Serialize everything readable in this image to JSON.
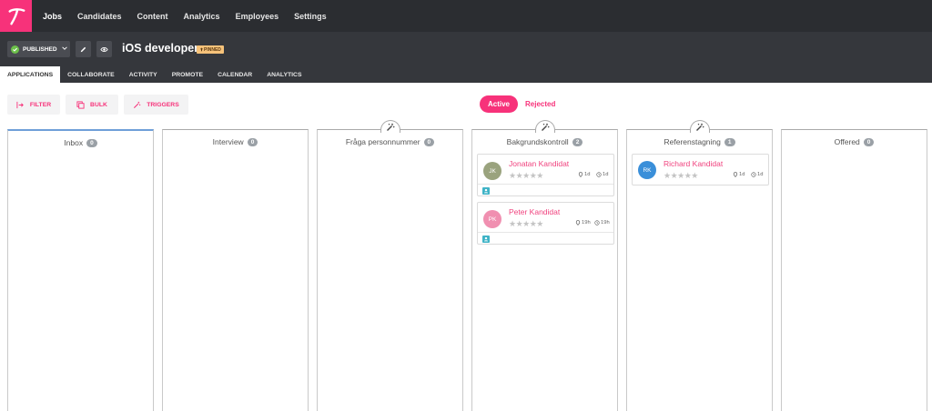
{
  "nav": {
    "items": [
      {
        "label": "Jobs"
      },
      {
        "label": "Candidates"
      },
      {
        "label": "Content"
      },
      {
        "label": "Analytics"
      },
      {
        "label": "Employees"
      },
      {
        "label": "Settings"
      }
    ],
    "active_index": 0
  },
  "job": {
    "status": "PUBLISHED",
    "title": "iOS developer",
    "badge": "PINNED"
  },
  "tabs": [
    {
      "label": "APPLICATIONS"
    },
    {
      "label": "COLLABORATE"
    },
    {
      "label": "ACTIVITY"
    },
    {
      "label": "PROMOTE"
    },
    {
      "label": "CALENDAR"
    },
    {
      "label": "ANALYTICS"
    }
  ],
  "toolbar": {
    "filter": "FILTER",
    "bulk": "BULK",
    "triggers": "TRIGGERS"
  },
  "toggle": {
    "active": "Active",
    "rejected": "Rejected"
  },
  "stages": [
    {
      "name": "Inbox",
      "count": "0"
    },
    {
      "name": "Interview",
      "count": "0"
    },
    {
      "name": "Fråga personnummer",
      "count": "0"
    },
    {
      "name": "Bakgrundskontroll",
      "count": "2"
    },
    {
      "name": "Referenstagning",
      "count": "1"
    },
    {
      "name": "Offered",
      "count": "0"
    }
  ],
  "candidates": {
    "jk": {
      "initials": "JK",
      "name": "Jonatan Kandidat",
      "stage_time": "1d",
      "time": "1d",
      "stars": "★★★★★",
      "color": "#9aa37e"
    },
    "pk": {
      "initials": "PK",
      "name": "Peter Kandidat",
      "stage_time": "19h",
      "time": "19h",
      "stars": "★★★★★",
      "color": "#f08fb0"
    },
    "rk": {
      "initials": "RK",
      "name": "Richard Kandidat",
      "stage_time": "1d",
      "time": "1d",
      "stars": "★★★★★",
      "color": "#3a8fd9"
    }
  },
  "colors": {
    "brand": "#f7327a",
    "nav_bg": "#2b2d31",
    "header_bg": "#35373c"
  }
}
